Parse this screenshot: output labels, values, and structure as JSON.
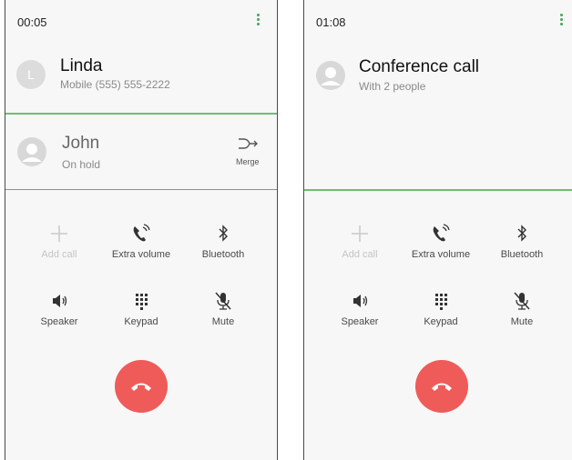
{
  "left_screen": {
    "timer": "00:05",
    "active_contact": {
      "initial": "L",
      "name": "Linda",
      "detail": "Mobile  (555) 555-2222"
    },
    "held_contact": {
      "name": "John",
      "status": "On hold"
    },
    "merge_label": "Merge",
    "actions": {
      "add_call": "Add call",
      "extra_volume": "Extra volume",
      "bluetooth": "Bluetooth",
      "speaker": "Speaker",
      "keypad": "Keypad",
      "mute": "Mute"
    }
  },
  "right_screen": {
    "timer": "01:08",
    "conference": {
      "name": "Conference call",
      "detail": "With 2 people"
    },
    "actions": {
      "add_call": "Add call",
      "extra_volume": "Extra volume",
      "bluetooth": "Bluetooth",
      "speaker": "Speaker",
      "keypad": "Keypad",
      "mute": "Mute"
    }
  },
  "colors": {
    "accent_green": "#6cc070",
    "end_call_red": "#ef5b59",
    "menu_dots": "#3bab55"
  },
  "icons": [
    "more-vert-icon",
    "avatar-icon",
    "merge-icon",
    "add-call-icon",
    "extra-volume-icon",
    "bluetooth-icon",
    "speaker-icon",
    "keypad-icon",
    "mute-icon",
    "end-call-icon"
  ]
}
